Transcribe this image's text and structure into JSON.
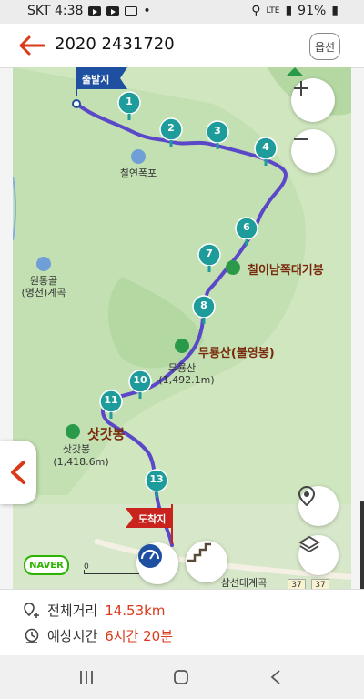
{
  "status_bar": {
    "carrier_time": "SKT 4:38",
    "dot": "•",
    "network": "LTE",
    "battery": "91%"
  },
  "app_bar": {
    "title": "2020 2431720",
    "options_label": "옵션"
  },
  "map": {
    "start_flag": "출발지",
    "end_flag": "도착지",
    "waypoints": [
      "1",
      "2",
      "3",
      "4",
      "6",
      "7",
      "8",
      "10",
      "11",
      "13"
    ],
    "labels": {
      "waterfall": "칠연폭포",
      "valley_a_1": "원통골",
      "valley_a_2": "(명천)계곡",
      "peak_1": "칠이남쪽대기봉",
      "peak_2": "무룡산(불영봉)",
      "peak_2_small_1": "무룡산",
      "peak_2_small_2": "(1,492.1m)",
      "peak_3": "삿갓봉",
      "peak_3_small_1": "삿갓봉",
      "peak_3_small_2": "(1,418.6m)",
      "valley_b": "삼선대계곡",
      "road_1": "37",
      "road_2": "37",
      "scale_value": "0"
    },
    "brand": "NAVER",
    "colors": {
      "route": "#5b48c8",
      "marker": "#1e9b9b",
      "flag_start": "#1f4fa0",
      "flag_end": "#c8241d",
      "peak_text": "#7a2a0c"
    }
  },
  "info": {
    "distance_label": "전체거리",
    "distance_value": "14.53km",
    "time_label": "예상시간",
    "time_value": "6시간 20분"
  }
}
